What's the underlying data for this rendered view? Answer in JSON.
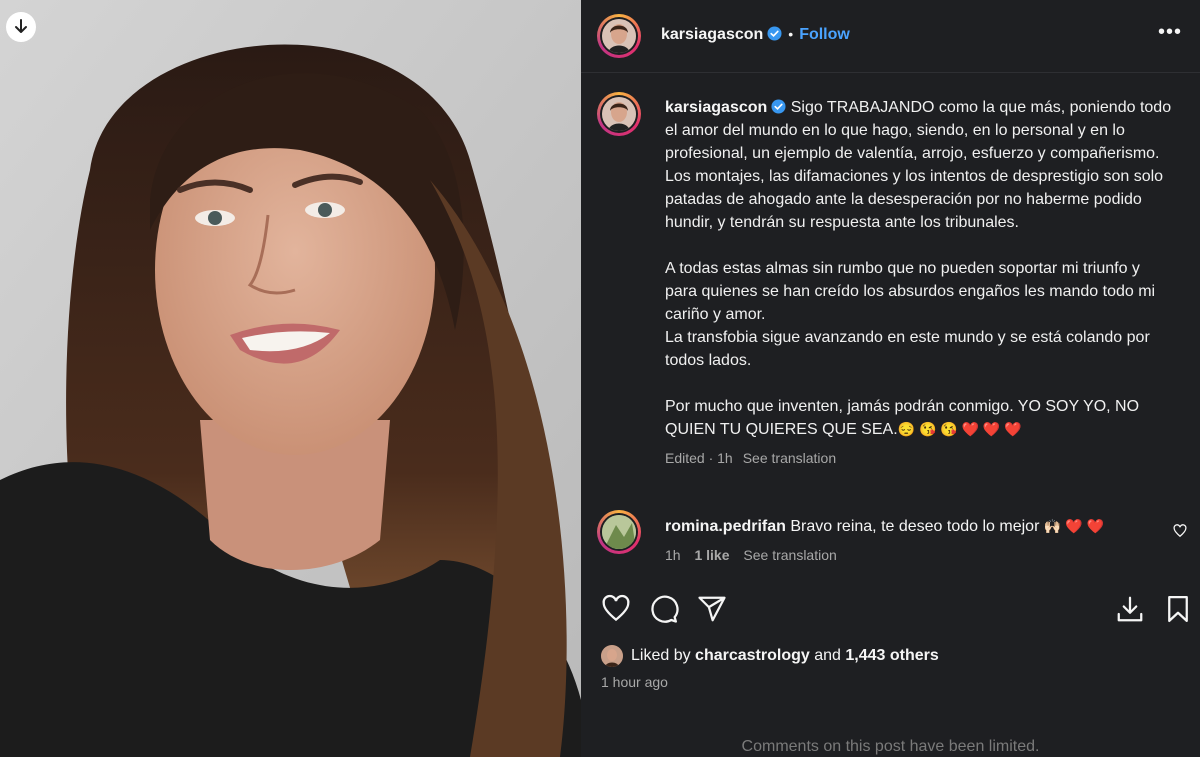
{
  "post": {
    "username": "karsiagascon",
    "follow_label": "Follow",
    "caption_lines": [
      "Sigo TRABAJANDO como la que más, poniendo todo el amor del mundo en lo que hago, siendo, en lo personal y en lo profesional, un ejemplo de valentía, arrojo, esfuerzo y compañerismo.",
      "Los montajes, las difamaciones y los intentos de desprestigio son solo patadas de ahogado ante la desesperación por no haberme podido hundir, y tendrán su respuesta ante los tribunales.",
      "A todas estas almas sin rumbo que no pueden soportar mi triunfo y para quienes se han creído los absurdos engaños les mando todo mi cariño y amor.",
      "La transfobia sigue avanzando en este mundo y se está colando por todos lados.",
      "Por mucho que inventen, jamás podrán conmigo. YO SOY YO, NO QUIEN TU QUIERES QUE SEA."
    ],
    "caption_emojis": "😔 😘 😘 ❤️ ❤️ ❤️",
    "caption_meta": {
      "edited": "Edited · 1h",
      "translation": "See translation"
    }
  },
  "comment": {
    "username": "romina.pedrifan",
    "text": "Bravo reina, te deseo todo lo mejor",
    "emojis": "🙌🏻 ❤️ ❤️",
    "time": "1h",
    "likes": "1 like",
    "translation": "See translation"
  },
  "likes": {
    "prefix": "Liked by",
    "user": "charcastrology",
    "and": "and",
    "count": "1,443 others"
  },
  "time_ago": "1 hour ago",
  "comments_limited": "Comments on this post have been limited.",
  "icons": [
    "download-icon",
    "verified-icon",
    "more-icon",
    "heart-icon",
    "comment-icon",
    "share-icon",
    "save-icon",
    "bookmark-icon"
  ],
  "colors": {
    "background": "#1e1f22",
    "link": "#4aa3ff",
    "muted": "#a8a8a8"
  }
}
